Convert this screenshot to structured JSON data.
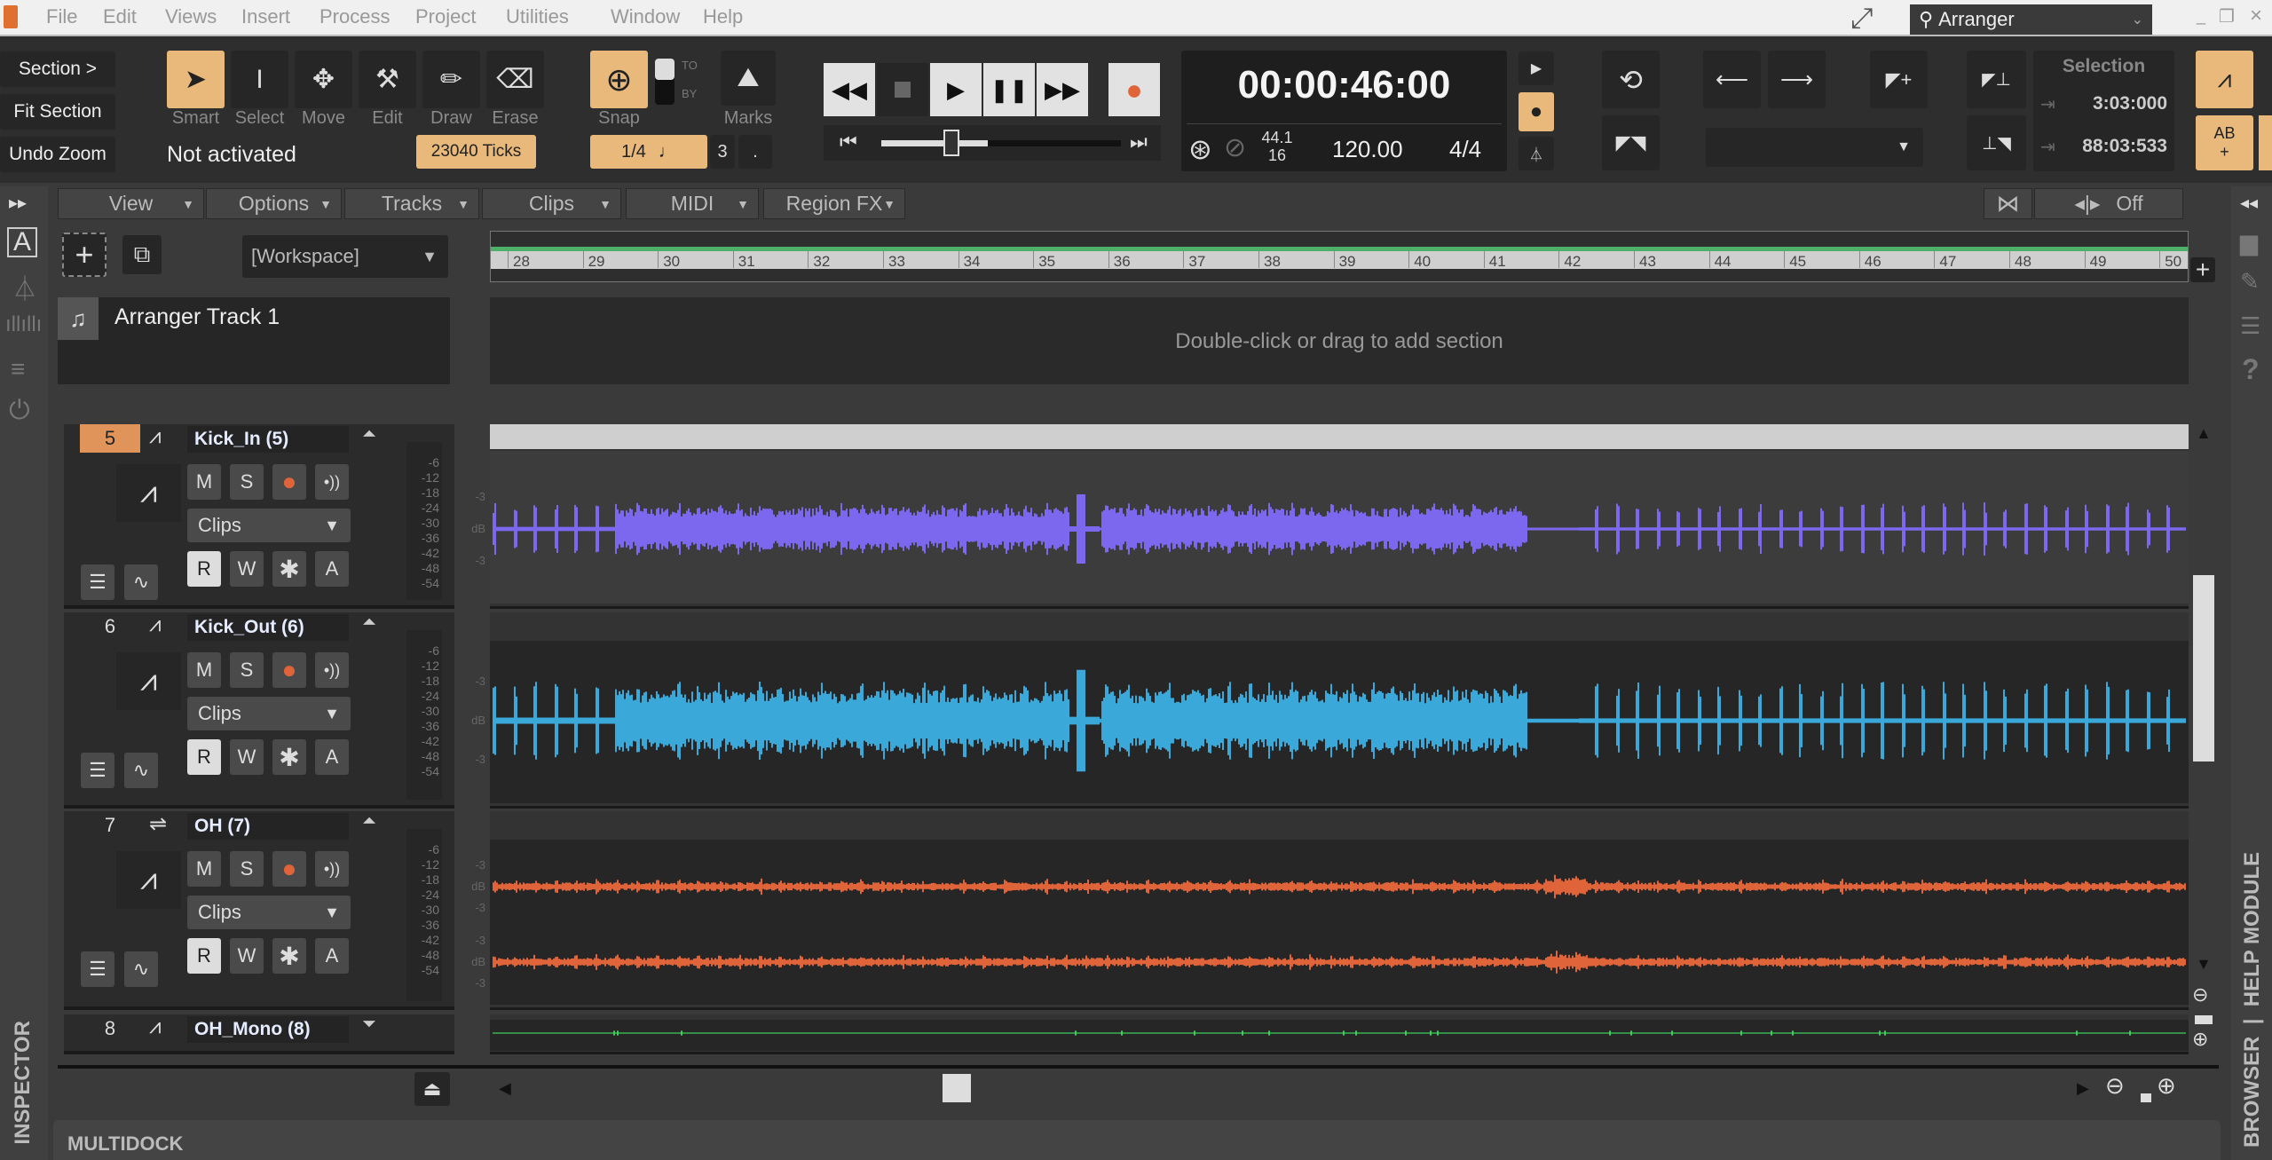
{
  "menubar": {
    "items": [
      "File",
      "Edit",
      "Views",
      "Insert",
      "Process",
      "Project",
      "Utilities",
      "Window",
      "Help"
    ],
    "screenset": "Arranger"
  },
  "toolbar": {
    "section": "Section >",
    "fit_section": "Fit Section",
    "undo_zoom": "Undo Zoom",
    "tools": [
      "Smart",
      "Select",
      "Move",
      "Edit",
      "Draw",
      "Erase"
    ],
    "active_tool": "Smart",
    "status": "Not activated",
    "ticks": "23040 Ticks",
    "snap": "Snap",
    "snap_to": "TO",
    "snap_by": "BY",
    "marks": "Marks",
    "snap_value": "1/4",
    "snap_triplet": "3",
    "snap_dot": ".",
    "time": "00:00:46:00",
    "sample_rate": "44.1",
    "bit_depth": "16",
    "tempo": "120.00",
    "meter": "4/4",
    "selection_title": "Selection",
    "selection_start": "3:03:000",
    "selection_end": "88:03:533",
    "ab_label": "AB"
  },
  "trackview": {
    "menus": [
      "View",
      "Options",
      "Tracks",
      "Clips",
      "MIDI",
      "Region FX"
    ],
    "snap_mode": "Off",
    "workspace": "[Workspace]",
    "arranger_track": "Arranger Track 1",
    "arranger_hint": "Double-click or drag to add section",
    "ruler": [
      "28",
      "29",
      "30",
      "31",
      "32",
      "33",
      "34",
      "35",
      "36",
      "37",
      "38",
      "39",
      "40",
      "41",
      "42",
      "43",
      "44",
      "45",
      "46",
      "47",
      "48",
      "49",
      "50"
    ],
    "db_scale": [
      "-6",
      "-12",
      "-18",
      "-24",
      "-30",
      "-36",
      "-42",
      "-48",
      "-54"
    ],
    "clip_db": [
      "-3",
      "dB",
      "-3"
    ],
    "tracks": [
      {
        "number": "5",
        "name": "Kick_In (5)",
        "selected": true,
        "type": "audio",
        "mode": "Clips",
        "buttons": [
          "M",
          "S",
          "R",
          "W",
          "A"
        ],
        "color": "#7b68ee"
      },
      {
        "number": "6",
        "name": "Kick_Out (6)",
        "selected": false,
        "type": "audio",
        "mode": "Clips",
        "buttons": [
          "M",
          "S",
          "R",
          "W",
          "A"
        ],
        "color": "#3aa8d8"
      },
      {
        "number": "7",
        "name": "OH (7)",
        "selected": false,
        "type": "stereo-bus",
        "mode": "Clips",
        "buttons": [
          "M",
          "S",
          "R",
          "W",
          "A"
        ],
        "color": "#e0643a"
      },
      {
        "number": "8",
        "name": "OH_Mono (8)",
        "selected": false,
        "type": "audio",
        "color": "#3ecf5a"
      }
    ]
  },
  "sidebar": {
    "inspector": "INSPECTOR",
    "browser": "BROWSER  |  HELP MODULE"
  },
  "multidock": "MULTIDOCK",
  "colors": {
    "accent": "#e8b97a",
    "track_selected": "#e0945a",
    "record": "#e0643a",
    "ruler_loop": "#4caf6a"
  }
}
